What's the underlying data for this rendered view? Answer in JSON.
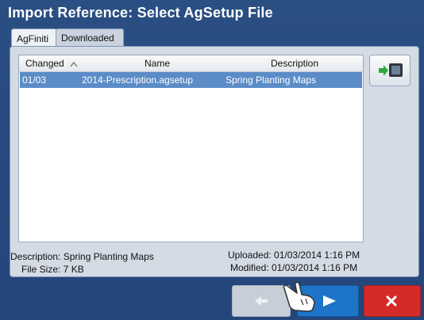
{
  "window": {
    "title": "Import Reference: Select AgSetup File"
  },
  "tabs": [
    {
      "label": "AgFiniti",
      "active": true
    },
    {
      "label": "Downloaded",
      "active": false
    }
  ],
  "list": {
    "headers": {
      "changed": "Changed",
      "name": "Name",
      "description": "Description"
    },
    "rows": [
      {
        "changed": "01/03",
        "name": "2014-Prescription.agsetup",
        "description": "Spring Planting Maps",
        "selected": true
      }
    ]
  },
  "details": {
    "description": "Description: Spring Planting Maps",
    "file_size": "File Size: 7 KB",
    "uploaded": "Uploaded: 01/03/2014 1:16 PM",
    "modified": "Modified: 01/03/2014 1:16 PM"
  },
  "buttons": {
    "prev_icon": "arrow-left-icon",
    "next_icon": "arrow-right-icon",
    "cancel_icon": "close-icon",
    "import_icon": "import-to-display-icon"
  },
  "colors": {
    "selected_row": "#5b8cc7",
    "next_button": "#1d74c8",
    "cancel_button": "#d42a2a"
  }
}
